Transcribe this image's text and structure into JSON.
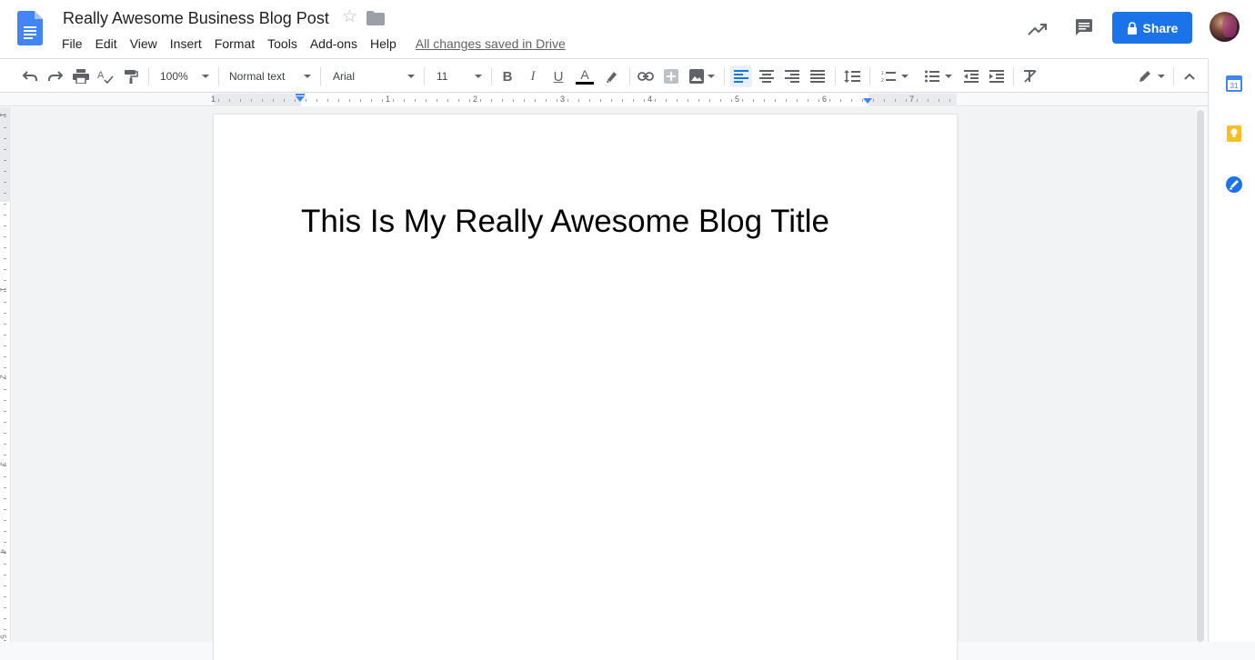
{
  "header": {
    "doc_title": "Really Awesome Business Blog Post",
    "saved_status": "All changes saved in Drive",
    "share_label": "Share",
    "menu": [
      "File",
      "Edit",
      "View",
      "Insert",
      "Format",
      "Tools",
      "Add-ons",
      "Help"
    ]
  },
  "toolbar": {
    "zoom": "100%",
    "style": "Normal text",
    "font": "Arial",
    "font_size": "11",
    "text_color_accent": "#000000",
    "active_alignment": "align-left"
  },
  "ruler": {
    "labels": [
      "1",
      "1",
      "2",
      "3",
      "4",
      "5",
      "6",
      "7"
    ]
  },
  "vruler": {
    "labels": [
      "1",
      "1",
      "2",
      "3",
      "4",
      "5"
    ]
  },
  "document": {
    "title_text": "This Is My Really Awesome Blog Title"
  },
  "sidepanel": {
    "calendar_label": "31"
  },
  "colors": {
    "share_blue": "#1a73e8",
    "docs_blue": "#4285f4",
    "keep_yellow": "#f6bf26"
  }
}
